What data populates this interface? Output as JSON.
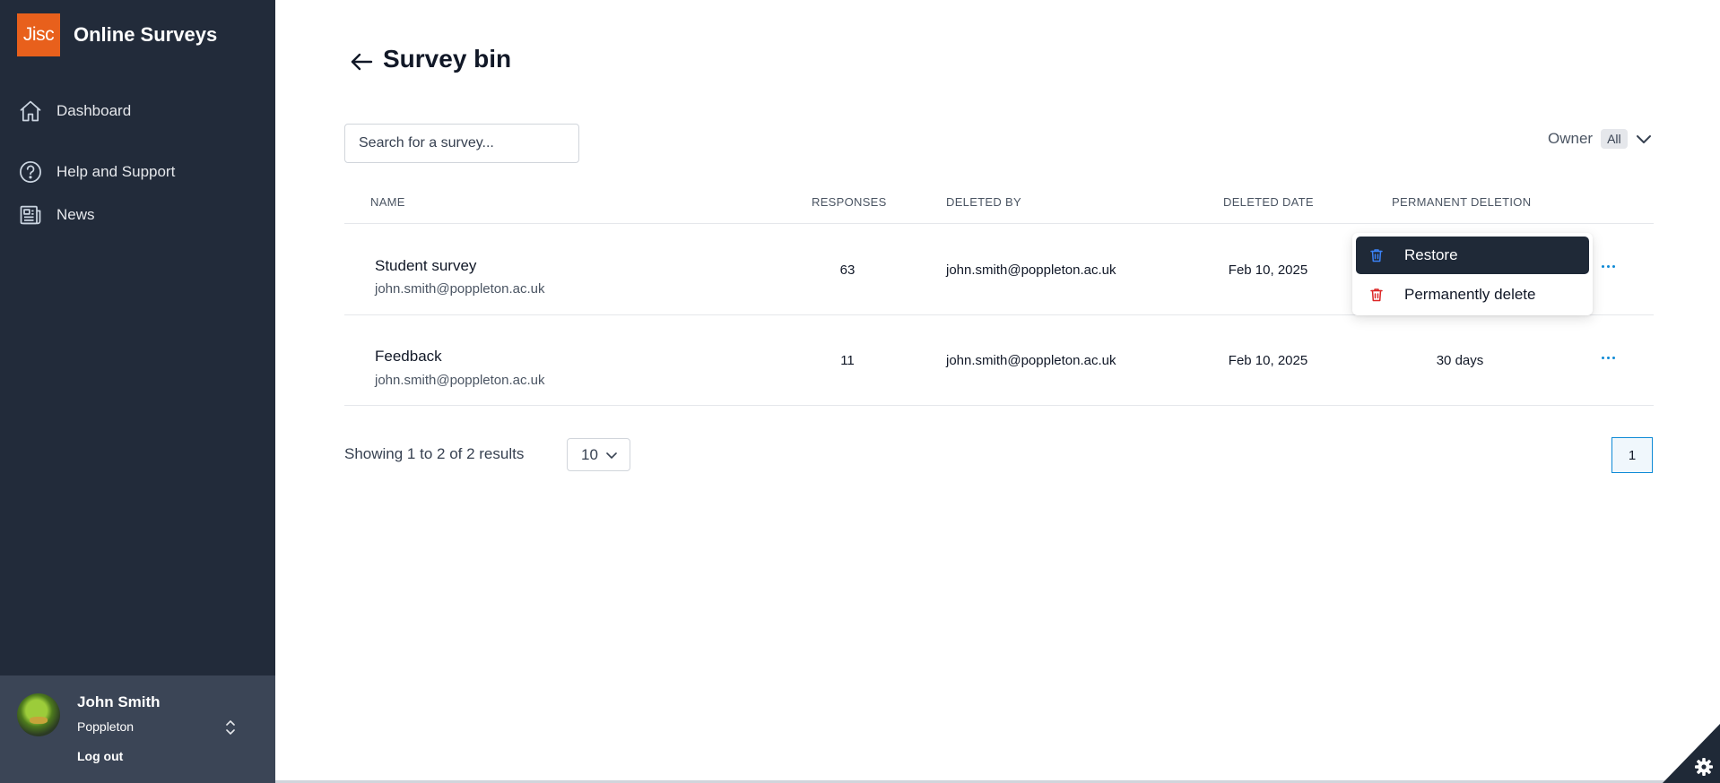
{
  "app": {
    "logo_text": "Jisc",
    "name": "Online Surveys"
  },
  "sidebar": {
    "items": [
      {
        "label": "Dashboard",
        "icon": "home-icon"
      },
      {
        "label": "Help and Support",
        "icon": "help-circle-icon"
      },
      {
        "label": "News",
        "icon": "newspaper-icon"
      }
    ]
  },
  "user": {
    "name": "John Smith",
    "organisation": "Poppleton",
    "logout_label": "Log out"
  },
  "page": {
    "title": "Survey bin"
  },
  "search": {
    "placeholder": "Search for a survey..."
  },
  "filter": {
    "label": "Owner",
    "value": "All"
  },
  "table": {
    "columns": [
      "NAME",
      "RESPONSES",
      "DELETED BY",
      "DELETED DATE",
      "PERMANENT DELETION"
    ],
    "rows": [
      {
        "name": "Student survey",
        "owner": "john.smith@poppleton.ac.uk",
        "responses": "63",
        "deleted_by": "john.smith@poppleton.ac.uk",
        "deleted_date": "Feb 10, 2025",
        "permanent_deletion": ""
      },
      {
        "name": "Feedback",
        "owner": "john.smith@poppleton.ac.uk",
        "responses": "11",
        "deleted_by": "john.smith@poppleton.ac.uk",
        "deleted_date": "Feb 10, 2025",
        "permanent_deletion": "30 days"
      }
    ]
  },
  "row_menu": {
    "restore_label": "Restore",
    "delete_label": "Permanently delete"
  },
  "pagination": {
    "summary": "Showing 1 to 2 of 2 results",
    "per_page": "10",
    "current_page": "1"
  },
  "colors": {
    "sidebar_bg": "#222b3a",
    "brand_orange": "#e8601c",
    "accent_blue": "#0e8ad6",
    "danger_red": "#dc2626"
  }
}
